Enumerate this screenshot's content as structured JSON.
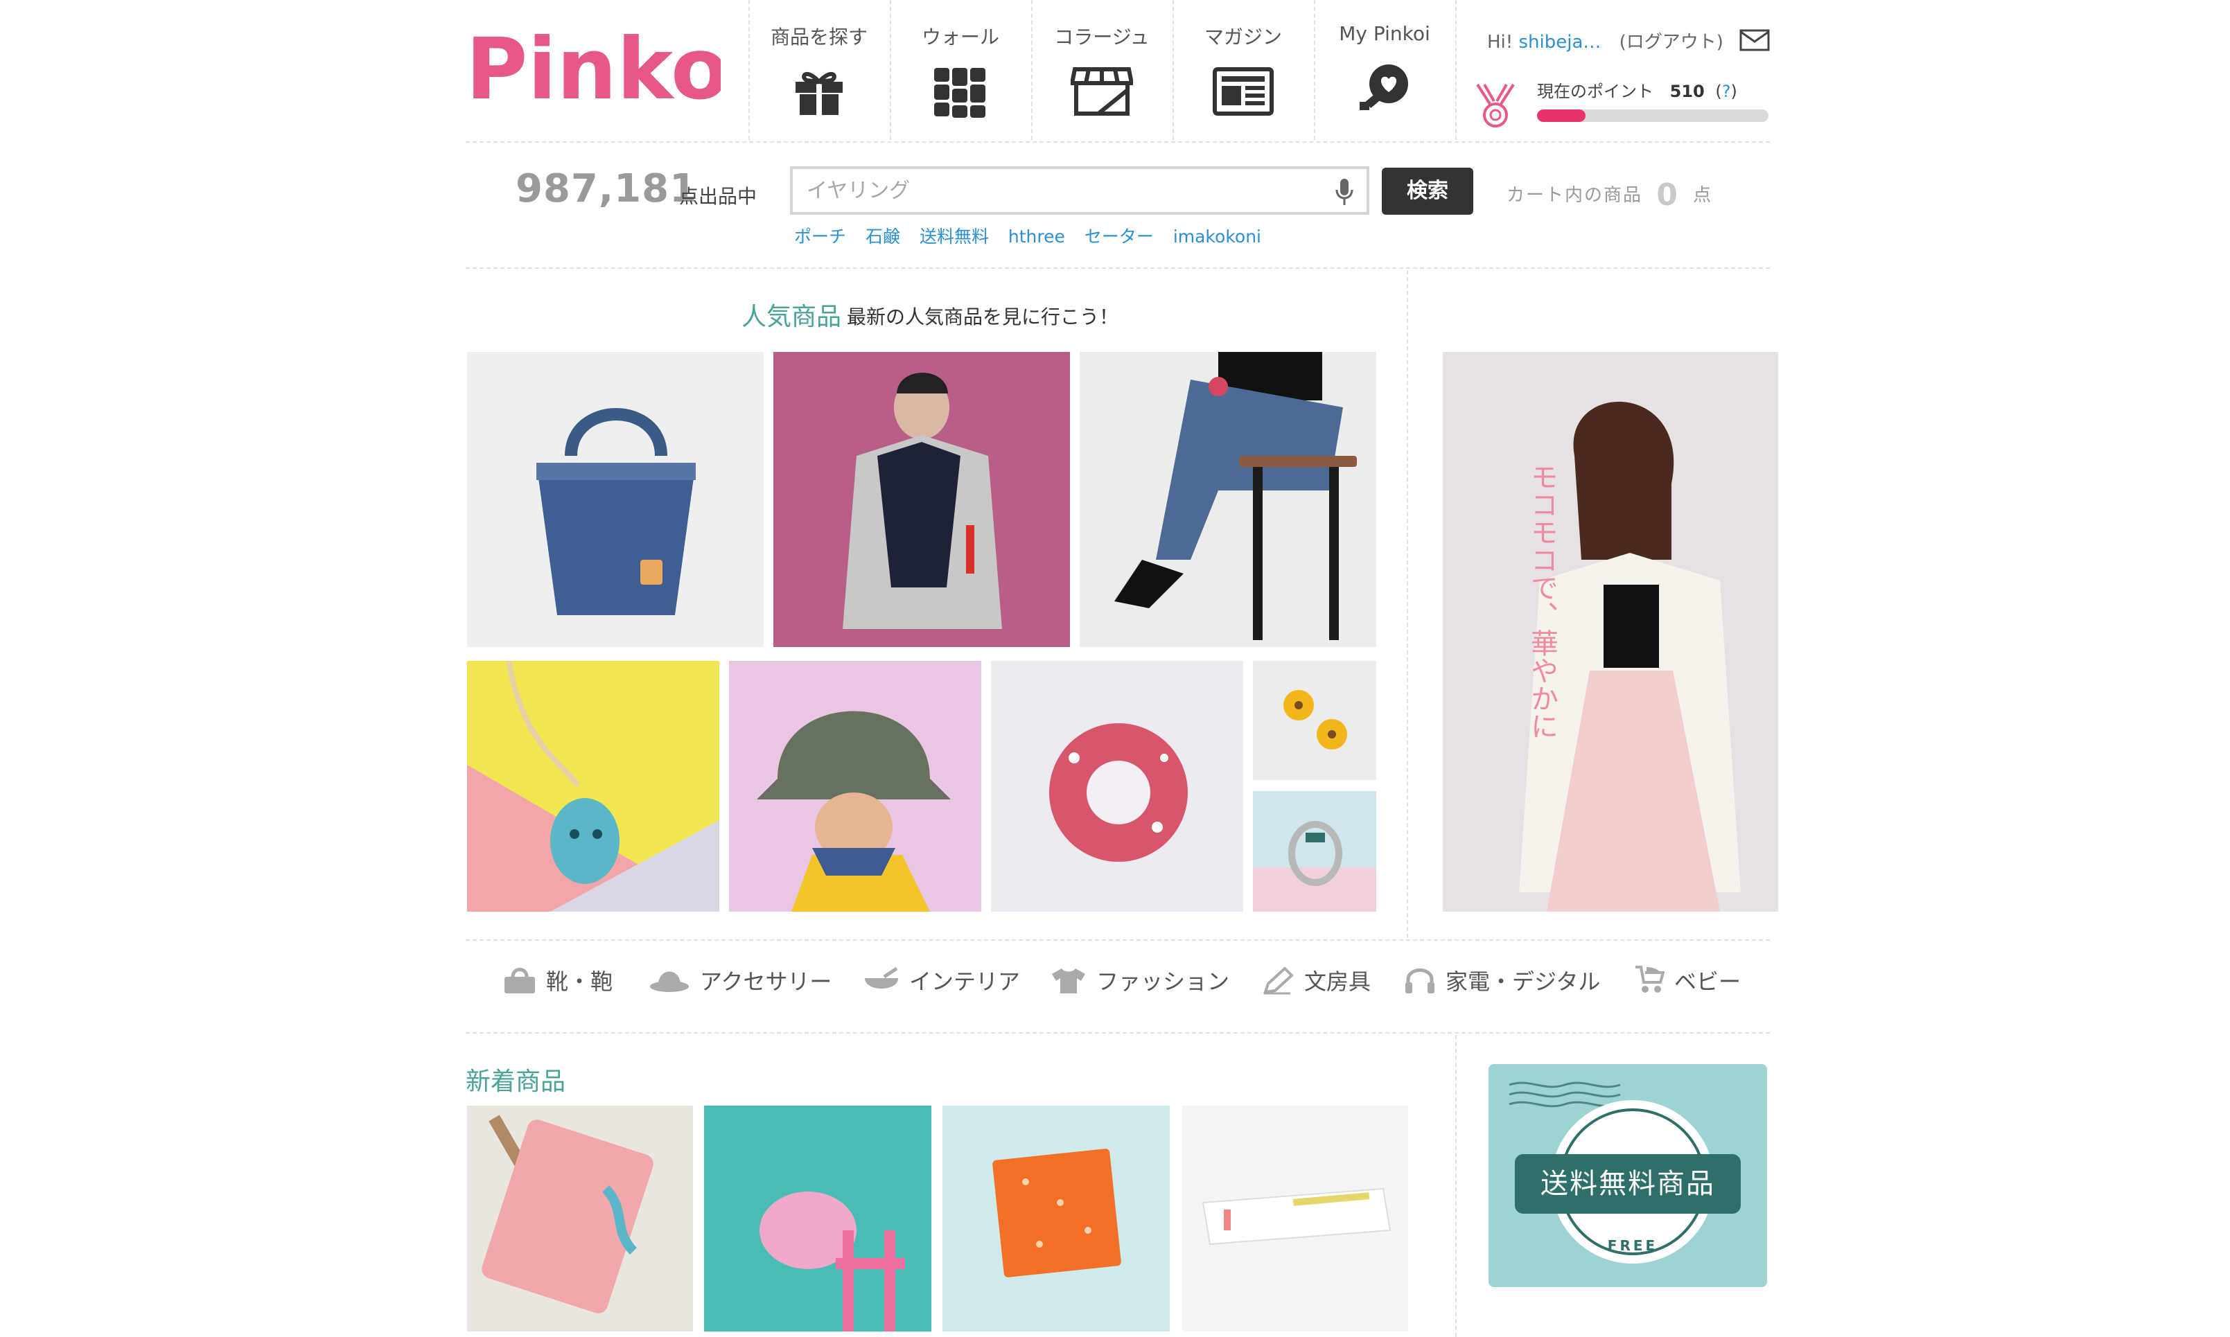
{
  "header": {
    "logo_text": "Pinkoi",
    "nav": [
      {
        "label": "商品を探す",
        "icon": "gift-icon"
      },
      {
        "label": "ウォール",
        "icon": "grid-icon"
      },
      {
        "label": "コラージュ",
        "icon": "store-icon"
      },
      {
        "label": "マガジン",
        "icon": "newspaper-icon"
      },
      {
        "label": "My Pinkoi",
        "icon": "heart-key-icon"
      }
    ],
    "user": {
      "greeting": "Hi!",
      "username": "shibeja…",
      "logout": "(ログアウト)"
    },
    "points": {
      "label": "現在のポイント",
      "value": "510",
      "help_open": "(",
      "help": "?",
      "help_close": ")",
      "progress": 0.21
    }
  },
  "search": {
    "count": "987,181",
    "count_label": "点出品中",
    "placeholder": "イヤリング",
    "button": "検索",
    "cart_label": "カート内の商品",
    "cart_count": "0",
    "cart_unit": "点",
    "tags": [
      "ポーチ",
      "石鹸",
      "送料無料",
      "hthree",
      "セーター",
      "imakokoni"
    ]
  },
  "popular": {
    "title": "人気商品",
    "subtitle": "最新の人気商品を見に行こう！",
    "banner_text": "モコモコで、華やかに"
  },
  "categories": [
    {
      "label": "靴・鞄",
      "icon": "bag-icon"
    },
    {
      "label": "アクセサリー",
      "icon": "hat-icon"
    },
    {
      "label": "インテリア",
      "icon": "bowl-icon"
    },
    {
      "label": "ファッション",
      "icon": "shirt-icon"
    },
    {
      "label": "文房具",
      "icon": "pencil-icon"
    },
    {
      "label": "家電・デジタル",
      "icon": "headphones-icon"
    },
    {
      "label": "ベビー",
      "icon": "stroller-icon"
    }
  ],
  "new_items": {
    "title": "新着商品"
  },
  "free_shipping": {
    "label": "送料無料商品",
    "stamp_text": "FREE"
  },
  "colors": {
    "brand_pink": "#e8336b",
    "teal": "#4aa396",
    "link_blue": "#2b8fd6"
  }
}
